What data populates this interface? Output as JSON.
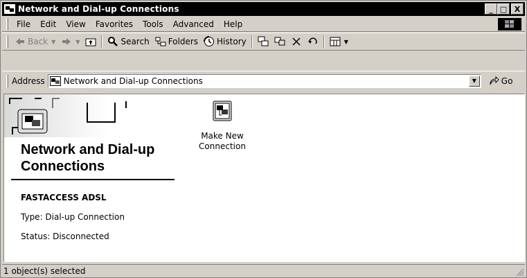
{
  "window": {
    "title": "Network and Dial-up Connections"
  },
  "window_controls": {
    "minimize": "_",
    "maximize": "□",
    "close": "X"
  },
  "menu": [
    "File",
    "Edit",
    "View",
    "Favorites",
    "Tools",
    "Advanced",
    "Help"
  ],
  "toolbar": {
    "back": "Back",
    "search": "Search",
    "folders": "Folders",
    "history": "History"
  },
  "address": {
    "label": "Address",
    "value": "Network and Dial-up Connections",
    "go": "Go"
  },
  "panel": {
    "heading": "Network and Dial-up Connections",
    "connection_name": "FASTACCESS ADSL",
    "type": "Type: Dial-up Connection",
    "status": "Status: Disconnected"
  },
  "items": [
    {
      "label": "Make New Connection",
      "icon": "make-new-connection-icon"
    }
  ],
  "statusbar": {
    "text": "1 object(s) selected"
  },
  "colors": {
    "titlebar": "#000000",
    "chrome": "#d4d0c8",
    "content": "#ffffff"
  }
}
